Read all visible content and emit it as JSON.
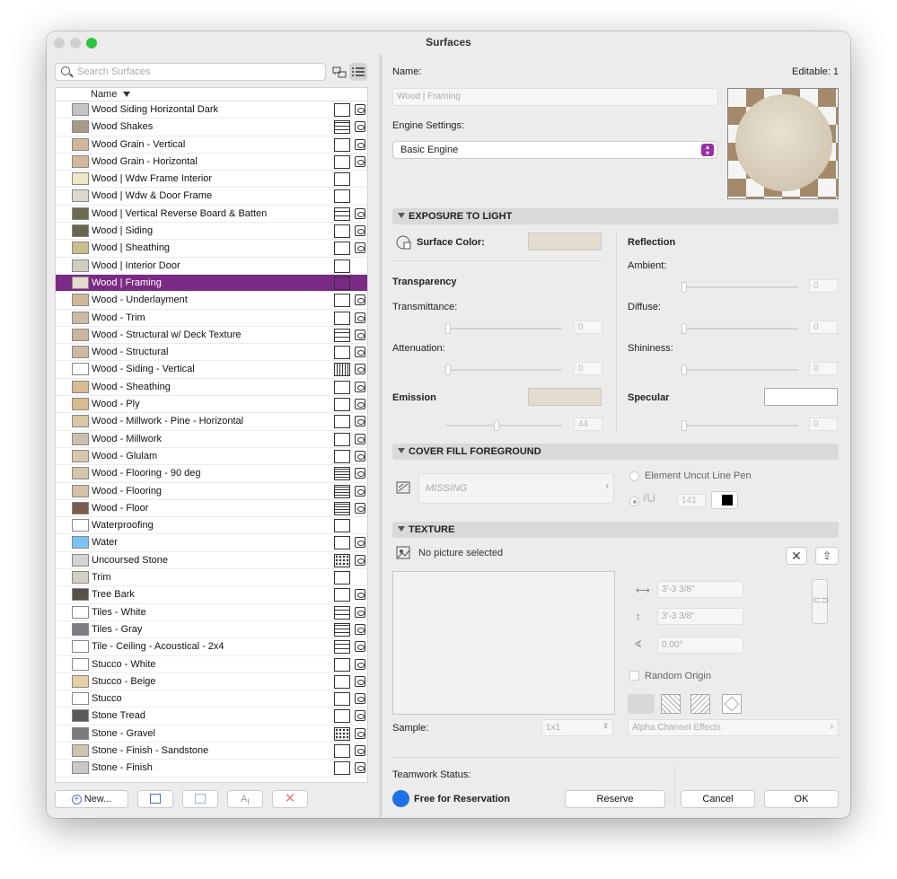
{
  "window": {
    "title": "Surfaces",
    "traffic": [
      "#d0d0d0",
      "#d0d0d0",
      "#2dc440"
    ]
  },
  "search": {
    "placeholder": "Search Surfaces"
  },
  "list": {
    "header": "Name",
    "rows": [
      {
        "label": "Wood Siding Horizontal Dark",
        "color": "#c4c4c4",
        "fill": "empty"
      },
      {
        "label": "Wood Shakes",
        "color": "#a89a86",
        "fill": "brick"
      },
      {
        "label": "Wood Grain - Vertical",
        "color": "#d2b698",
        "fill": "empty"
      },
      {
        "label": "Wood Grain - Horizontal",
        "color": "#d3b79a",
        "fill": "empty"
      },
      {
        "label": "Wood | Wdw Frame Interior",
        "color": "#ede9c8",
        "fill": "empty",
        "notex": true
      },
      {
        "label": "Wood | Wdw & Door Frame",
        "color": "#dcd8cf",
        "fill": "empty",
        "notex": true
      },
      {
        "label": "Wood | Vertical Reverse Board & Batten",
        "color": "#6e6a52",
        "fill": "grid"
      },
      {
        "label": "Wood | Siding",
        "color": "#6a654d",
        "fill": "empty"
      },
      {
        "label": "Wood | Sheathing",
        "color": "#c9bd8a",
        "fill": "empty"
      },
      {
        "label": "Wood | Interior Door",
        "color": "#d3cbbd",
        "fill": "empty",
        "notex": true
      },
      {
        "label": "Wood | Framing",
        "color": "#e2dacb",
        "fill": "empty",
        "notex": true,
        "selected": true
      },
      {
        "label": "Wood - Underlayment",
        "color": "#d0b898",
        "fill": "empty"
      },
      {
        "label": "Wood - Trim",
        "color": "#cbb9a3",
        "fill": "empty"
      },
      {
        "label": "Wood - Structural w/ Deck Texture",
        "color": "#c8b59c",
        "fill": "grid"
      },
      {
        "label": "Wood - Structural",
        "color": "#cdb9a1",
        "fill": "empty"
      },
      {
        "label": "Wood - Siding - Vertical",
        "color": "#ffffff",
        "fill": "vlines"
      },
      {
        "label": "Wood - Sheathing",
        "color": "#d9bc91",
        "fill": "empty"
      },
      {
        "label": "Wood - Ply",
        "color": "#d9bc8f",
        "fill": "empty"
      },
      {
        "label": "Wood - Millwork - Pine - Horizontal",
        "color": "#d9c7a3",
        "fill": "empty"
      },
      {
        "label": "Wood - Millwork",
        "color": "#cdbfae",
        "fill": "empty"
      },
      {
        "label": "Wood - Glulam",
        "color": "#d9c6a9",
        "fill": "empty"
      },
      {
        "label": "Wood - Flooring - 90 deg",
        "color": "#d6c4a8",
        "fill": "hlines"
      },
      {
        "label": "Wood - Flooring",
        "color": "#d4c2a6",
        "fill": "hlines"
      },
      {
        "label": "Wood - Floor",
        "color": "#7b5c4c",
        "fill": "hlines"
      },
      {
        "label": "Waterproofing",
        "color": "#ffffff",
        "fill": "empty",
        "notex": true
      },
      {
        "label": "Water",
        "color": "#78c4f6",
        "fill": "empty"
      },
      {
        "label": "Uncoursed Stone",
        "color": "#d3d3d3",
        "fill": "stone"
      },
      {
        "label": "Trim",
        "color": "#d3cfc4",
        "fill": "empty",
        "notex": true
      },
      {
        "label": "Tree Bark",
        "color": "#55504a",
        "fill": "empty"
      },
      {
        "label": "Tiles - White",
        "color": "#ffffff",
        "fill": "grid"
      },
      {
        "label": "Tiles - Gray",
        "color": "#7d7d82",
        "fill": "brick"
      },
      {
        "label": "Tile - Ceiling - Acoustical - 2x4",
        "color": "#ffffff",
        "fill": "grid"
      },
      {
        "label": "Stucco - White",
        "color": "#ffffff",
        "fill": "empty"
      },
      {
        "label": "Stucco - Beige",
        "color": "#e8cfa5",
        "fill": "empty"
      },
      {
        "label": "Stucco",
        "color": "#ffffff",
        "fill": "empty"
      },
      {
        "label": "Stone Tread",
        "color": "#59595b",
        "fill": "empty"
      },
      {
        "label": "Stone - Gravel",
        "color": "#7b7b7b",
        "fill": "stone"
      },
      {
        "label": "Stone - Finish - Sandstone",
        "color": "#d0c3b3",
        "fill": "empty"
      },
      {
        "label": "Stone - Finish",
        "color": "#c8c8c8",
        "fill": "empty"
      }
    ]
  },
  "bottom_left": {
    "new_label": "New..."
  },
  "name_label": "Name:",
  "editable_label": "Editable: 1",
  "name_value": "Wood | Framing",
  "engine_label": "Engine Settings:",
  "engine_value": "Basic Engine",
  "exposure": {
    "title": "EXPOSURE TO LIGHT",
    "surface_color": "Surface Color:",
    "surface_color_hex": "#e3dccf",
    "transparency": "Transparency",
    "transmittance": "Transmittance:",
    "transmittance_value": "0",
    "attenuation": "Attenuation:",
    "attenuation_value": "0",
    "emission": "Emission",
    "emission_value": "44",
    "reflection": "Reflection",
    "ambient": "Ambient:",
    "ambient_value": "0",
    "diffuse": "Diffuse:",
    "diffuse_value": "0",
    "shininess": "Shininess:",
    "shininess_value": "0",
    "specular": "Specular",
    "specular_value": "0"
  },
  "cover": {
    "title": "COVER FILL FOREGROUND",
    "fill_name": "MISSING",
    "uncut": "Element Uncut Line Pen",
    "pen_value": "141"
  },
  "texture": {
    "title": "TEXTURE",
    "no_picture": "No picture selected",
    "width": "3'-3 3/8\"",
    "height": "3'-3 3/8\"",
    "angle": "0.00°",
    "random_origin": "Random Origin",
    "sample_label": "Sample:",
    "sample_value": "1x1",
    "alpha": "Alpha Channel Effects"
  },
  "footer": {
    "teamwork_label": "Teamwork Status:",
    "status": "Free for Reservation",
    "reserve": "Reserve",
    "cancel": "Cancel",
    "ok": "OK"
  }
}
